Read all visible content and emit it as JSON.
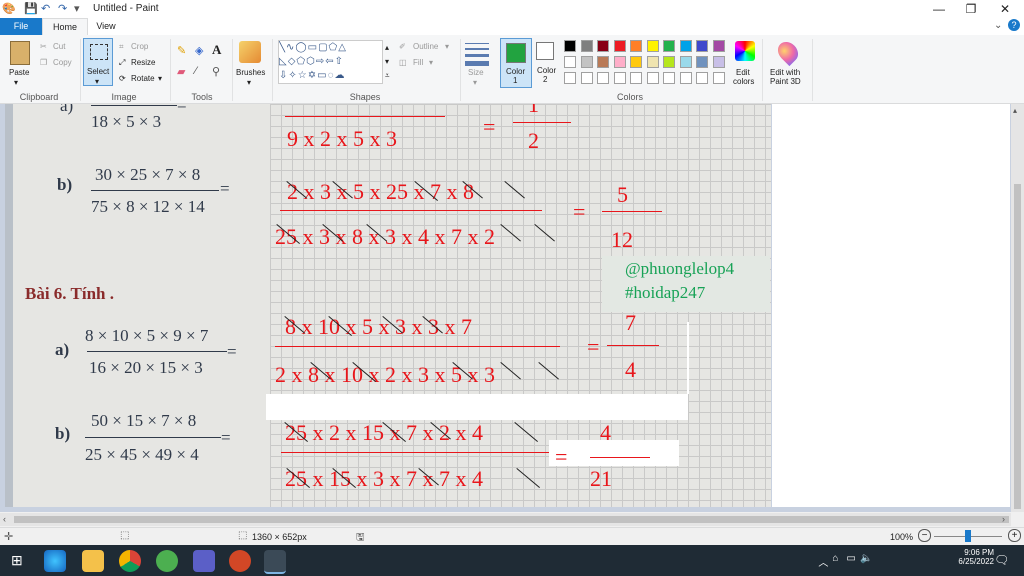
{
  "window": {
    "title": "Untitled - Paint",
    "minimize": "—",
    "maximize": "❐",
    "close": "✕"
  },
  "tabs": [
    {
      "label": "File"
    },
    {
      "label": "Home"
    },
    {
      "label": "View"
    }
  ],
  "ribbon": {
    "clipboard": {
      "group": "Clipboard",
      "paste": "Paste",
      "cut": "Cut",
      "copy": "Copy"
    },
    "image": {
      "group": "Image",
      "select": "Select",
      "crop": "Crop",
      "resize": "Resize",
      "rotate": "Rotate"
    },
    "tools": {
      "group": "Tools"
    },
    "brushes": {
      "label": "Brushes"
    },
    "shapes": {
      "group": "Shapes",
      "outline": "Outline",
      "fill": "Fill"
    },
    "size": {
      "label": "Size"
    },
    "color1": {
      "label": "Color",
      "num": "1",
      "value": "#22a340"
    },
    "color2": {
      "label": "Color",
      "num": "2",
      "value": "#ffffff"
    },
    "colors": {
      "group": "Colors"
    },
    "edit_colors": {
      "line1": "Edit",
      "line2": "colors"
    },
    "paint3d": {
      "line1": "Edit with",
      "line2": "Paint 3D"
    }
  },
  "palette": [
    "#000000",
    "#7f7f7f",
    "#880015",
    "#ed1c24",
    "#ff7f27",
    "#fff200",
    "#22b14c",
    "#00a2e8",
    "#3f48cc",
    "#a349a4",
    "#ffffff",
    "#c3c3c3",
    "#b97a57",
    "#ffaec9",
    "#ffc90e",
    "#efe4b0",
    "#b5e61d",
    "#99d9ea",
    "#7092be",
    "#c8bfe7",
    "#ffffff",
    "#ffffff",
    "#ffffff",
    "#ffffff",
    "#ffffff",
    "#ffffff",
    "#ffffff",
    "#ffffff",
    "#ffffff",
    "#ffffff"
  ],
  "document": {
    "top_fraction": "18 × 5 × 3",
    "top_eq": "=",
    "top_red_den": "9 x 2 x 5 x 3",
    "top_red_eq": "=",
    "top_red_res_num": "1",
    "top_red_res_den": "2",
    "b1_label": "b)",
    "b1_num": "30 × 25 × 7 × 8",
    "b1_den": "75 × 8 × 12 × 14",
    "b1_eq": "=",
    "b1_red_num": "2 x 3 x 5 x 25 x 7 x 8",
    "b1_red_den": "25 x 3 x 8 x 3 x 4 x 7 x 2",
    "b1_red_eq": "=",
    "b1_res_num": "5",
    "b1_res_den": "12",
    "bai6": "Bài 6. Tính .",
    "watermark1": "@phuonglelop4",
    "watermark2": "#hoidap247",
    "a_label": "a)",
    "a_num": "8 × 10 × 5 × 9 × 7",
    "a_den": "16 × 20 × 15 × 3",
    "a_eq": "=",
    "a_red_num": "8 x 10 x 5 x 3 x 3 x 7",
    "a_red_den": "2 x 8 x 10 x 2 x 3 x 5 x 3",
    "a_red_eq": "=",
    "a_res_num": "7",
    "a_res_den": "4",
    "b2_label": "b)",
    "b2_num": "50 × 15 × 7 × 8",
    "b2_den": "25 × 45 × 49 × 4",
    "b2_eq": "=",
    "b2_red_num": "25 x 2 x 15 x 7 x 2 x 4",
    "b2_red_den": "25 x 15 x 3 x 7 x 7 x 4",
    "b2_red_eq": "=",
    "b2_res_num": "4",
    "b2_res_den": "21"
  },
  "status": {
    "image_size": "1360 × 652px",
    "zoom": "100%"
  },
  "taskbar": {
    "time": "9:06 PM",
    "date": "6/25/2022"
  }
}
